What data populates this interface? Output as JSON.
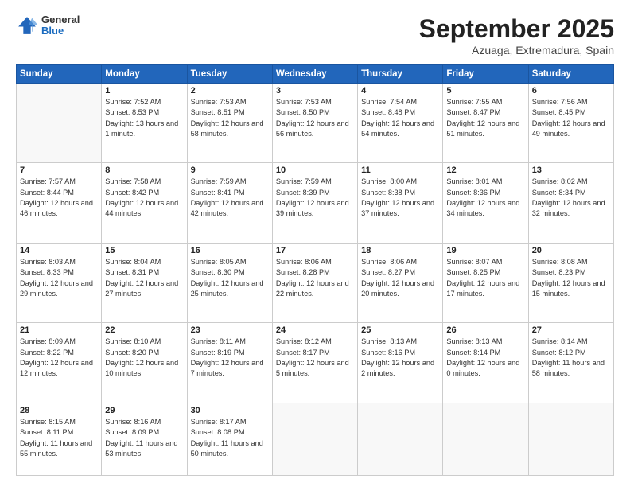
{
  "header": {
    "logo": {
      "general": "General",
      "blue": "Blue"
    },
    "title": "September 2025",
    "location": "Azuaga, Extremadura, Spain"
  },
  "days_of_week": [
    "Sunday",
    "Monday",
    "Tuesday",
    "Wednesday",
    "Thursday",
    "Friday",
    "Saturday"
  ],
  "weeks": [
    [
      {
        "day": "",
        "sunrise": "",
        "sunset": "",
        "daylight": "",
        "empty": true
      },
      {
        "day": "1",
        "sunrise": "Sunrise: 7:52 AM",
        "sunset": "Sunset: 8:53 PM",
        "daylight": "Daylight: 13 hours and 1 minute."
      },
      {
        "day": "2",
        "sunrise": "Sunrise: 7:53 AM",
        "sunset": "Sunset: 8:51 PM",
        "daylight": "Daylight: 12 hours and 58 minutes."
      },
      {
        "day": "3",
        "sunrise": "Sunrise: 7:53 AM",
        "sunset": "Sunset: 8:50 PM",
        "daylight": "Daylight: 12 hours and 56 minutes."
      },
      {
        "day": "4",
        "sunrise": "Sunrise: 7:54 AM",
        "sunset": "Sunset: 8:48 PM",
        "daylight": "Daylight: 12 hours and 54 minutes."
      },
      {
        "day": "5",
        "sunrise": "Sunrise: 7:55 AM",
        "sunset": "Sunset: 8:47 PM",
        "daylight": "Daylight: 12 hours and 51 minutes."
      },
      {
        "day": "6",
        "sunrise": "Sunrise: 7:56 AM",
        "sunset": "Sunset: 8:45 PM",
        "daylight": "Daylight: 12 hours and 49 minutes."
      }
    ],
    [
      {
        "day": "7",
        "sunrise": "Sunrise: 7:57 AM",
        "sunset": "Sunset: 8:44 PM",
        "daylight": "Daylight: 12 hours and 46 minutes."
      },
      {
        "day": "8",
        "sunrise": "Sunrise: 7:58 AM",
        "sunset": "Sunset: 8:42 PM",
        "daylight": "Daylight: 12 hours and 44 minutes."
      },
      {
        "day": "9",
        "sunrise": "Sunrise: 7:59 AM",
        "sunset": "Sunset: 8:41 PM",
        "daylight": "Daylight: 12 hours and 42 minutes."
      },
      {
        "day": "10",
        "sunrise": "Sunrise: 7:59 AM",
        "sunset": "Sunset: 8:39 PM",
        "daylight": "Daylight: 12 hours and 39 minutes."
      },
      {
        "day": "11",
        "sunrise": "Sunrise: 8:00 AM",
        "sunset": "Sunset: 8:38 PM",
        "daylight": "Daylight: 12 hours and 37 minutes."
      },
      {
        "day": "12",
        "sunrise": "Sunrise: 8:01 AM",
        "sunset": "Sunset: 8:36 PM",
        "daylight": "Daylight: 12 hours and 34 minutes."
      },
      {
        "day": "13",
        "sunrise": "Sunrise: 8:02 AM",
        "sunset": "Sunset: 8:34 PM",
        "daylight": "Daylight: 12 hours and 32 minutes."
      }
    ],
    [
      {
        "day": "14",
        "sunrise": "Sunrise: 8:03 AM",
        "sunset": "Sunset: 8:33 PM",
        "daylight": "Daylight: 12 hours and 29 minutes."
      },
      {
        "day": "15",
        "sunrise": "Sunrise: 8:04 AM",
        "sunset": "Sunset: 8:31 PM",
        "daylight": "Daylight: 12 hours and 27 minutes."
      },
      {
        "day": "16",
        "sunrise": "Sunrise: 8:05 AM",
        "sunset": "Sunset: 8:30 PM",
        "daylight": "Daylight: 12 hours and 25 minutes."
      },
      {
        "day": "17",
        "sunrise": "Sunrise: 8:06 AM",
        "sunset": "Sunset: 8:28 PM",
        "daylight": "Daylight: 12 hours and 22 minutes."
      },
      {
        "day": "18",
        "sunrise": "Sunrise: 8:06 AM",
        "sunset": "Sunset: 8:27 PM",
        "daylight": "Daylight: 12 hours and 20 minutes."
      },
      {
        "day": "19",
        "sunrise": "Sunrise: 8:07 AM",
        "sunset": "Sunset: 8:25 PM",
        "daylight": "Daylight: 12 hours and 17 minutes."
      },
      {
        "day": "20",
        "sunrise": "Sunrise: 8:08 AM",
        "sunset": "Sunset: 8:23 PM",
        "daylight": "Daylight: 12 hours and 15 minutes."
      }
    ],
    [
      {
        "day": "21",
        "sunrise": "Sunrise: 8:09 AM",
        "sunset": "Sunset: 8:22 PM",
        "daylight": "Daylight: 12 hours and 12 minutes."
      },
      {
        "day": "22",
        "sunrise": "Sunrise: 8:10 AM",
        "sunset": "Sunset: 8:20 PM",
        "daylight": "Daylight: 12 hours and 10 minutes."
      },
      {
        "day": "23",
        "sunrise": "Sunrise: 8:11 AM",
        "sunset": "Sunset: 8:19 PM",
        "daylight": "Daylight: 12 hours and 7 minutes."
      },
      {
        "day": "24",
        "sunrise": "Sunrise: 8:12 AM",
        "sunset": "Sunset: 8:17 PM",
        "daylight": "Daylight: 12 hours and 5 minutes."
      },
      {
        "day": "25",
        "sunrise": "Sunrise: 8:13 AM",
        "sunset": "Sunset: 8:16 PM",
        "daylight": "Daylight: 12 hours and 2 minutes."
      },
      {
        "day": "26",
        "sunrise": "Sunrise: 8:13 AM",
        "sunset": "Sunset: 8:14 PM",
        "daylight": "Daylight: 12 hours and 0 minutes."
      },
      {
        "day": "27",
        "sunrise": "Sunrise: 8:14 AM",
        "sunset": "Sunset: 8:12 PM",
        "daylight": "Daylight: 11 hours and 58 minutes."
      }
    ],
    [
      {
        "day": "28",
        "sunrise": "Sunrise: 8:15 AM",
        "sunset": "Sunset: 8:11 PM",
        "daylight": "Daylight: 11 hours and 55 minutes."
      },
      {
        "day": "29",
        "sunrise": "Sunrise: 8:16 AM",
        "sunset": "Sunset: 8:09 PM",
        "daylight": "Daylight: 11 hours and 53 minutes."
      },
      {
        "day": "30",
        "sunrise": "Sunrise: 8:17 AM",
        "sunset": "Sunset: 8:08 PM",
        "daylight": "Daylight: 11 hours and 50 minutes."
      },
      {
        "day": "",
        "sunrise": "",
        "sunset": "",
        "daylight": "",
        "empty": true
      },
      {
        "day": "",
        "sunrise": "",
        "sunset": "",
        "daylight": "",
        "empty": true
      },
      {
        "day": "",
        "sunrise": "",
        "sunset": "",
        "daylight": "",
        "empty": true
      },
      {
        "day": "",
        "sunrise": "",
        "sunset": "",
        "daylight": "",
        "empty": true
      }
    ]
  ]
}
